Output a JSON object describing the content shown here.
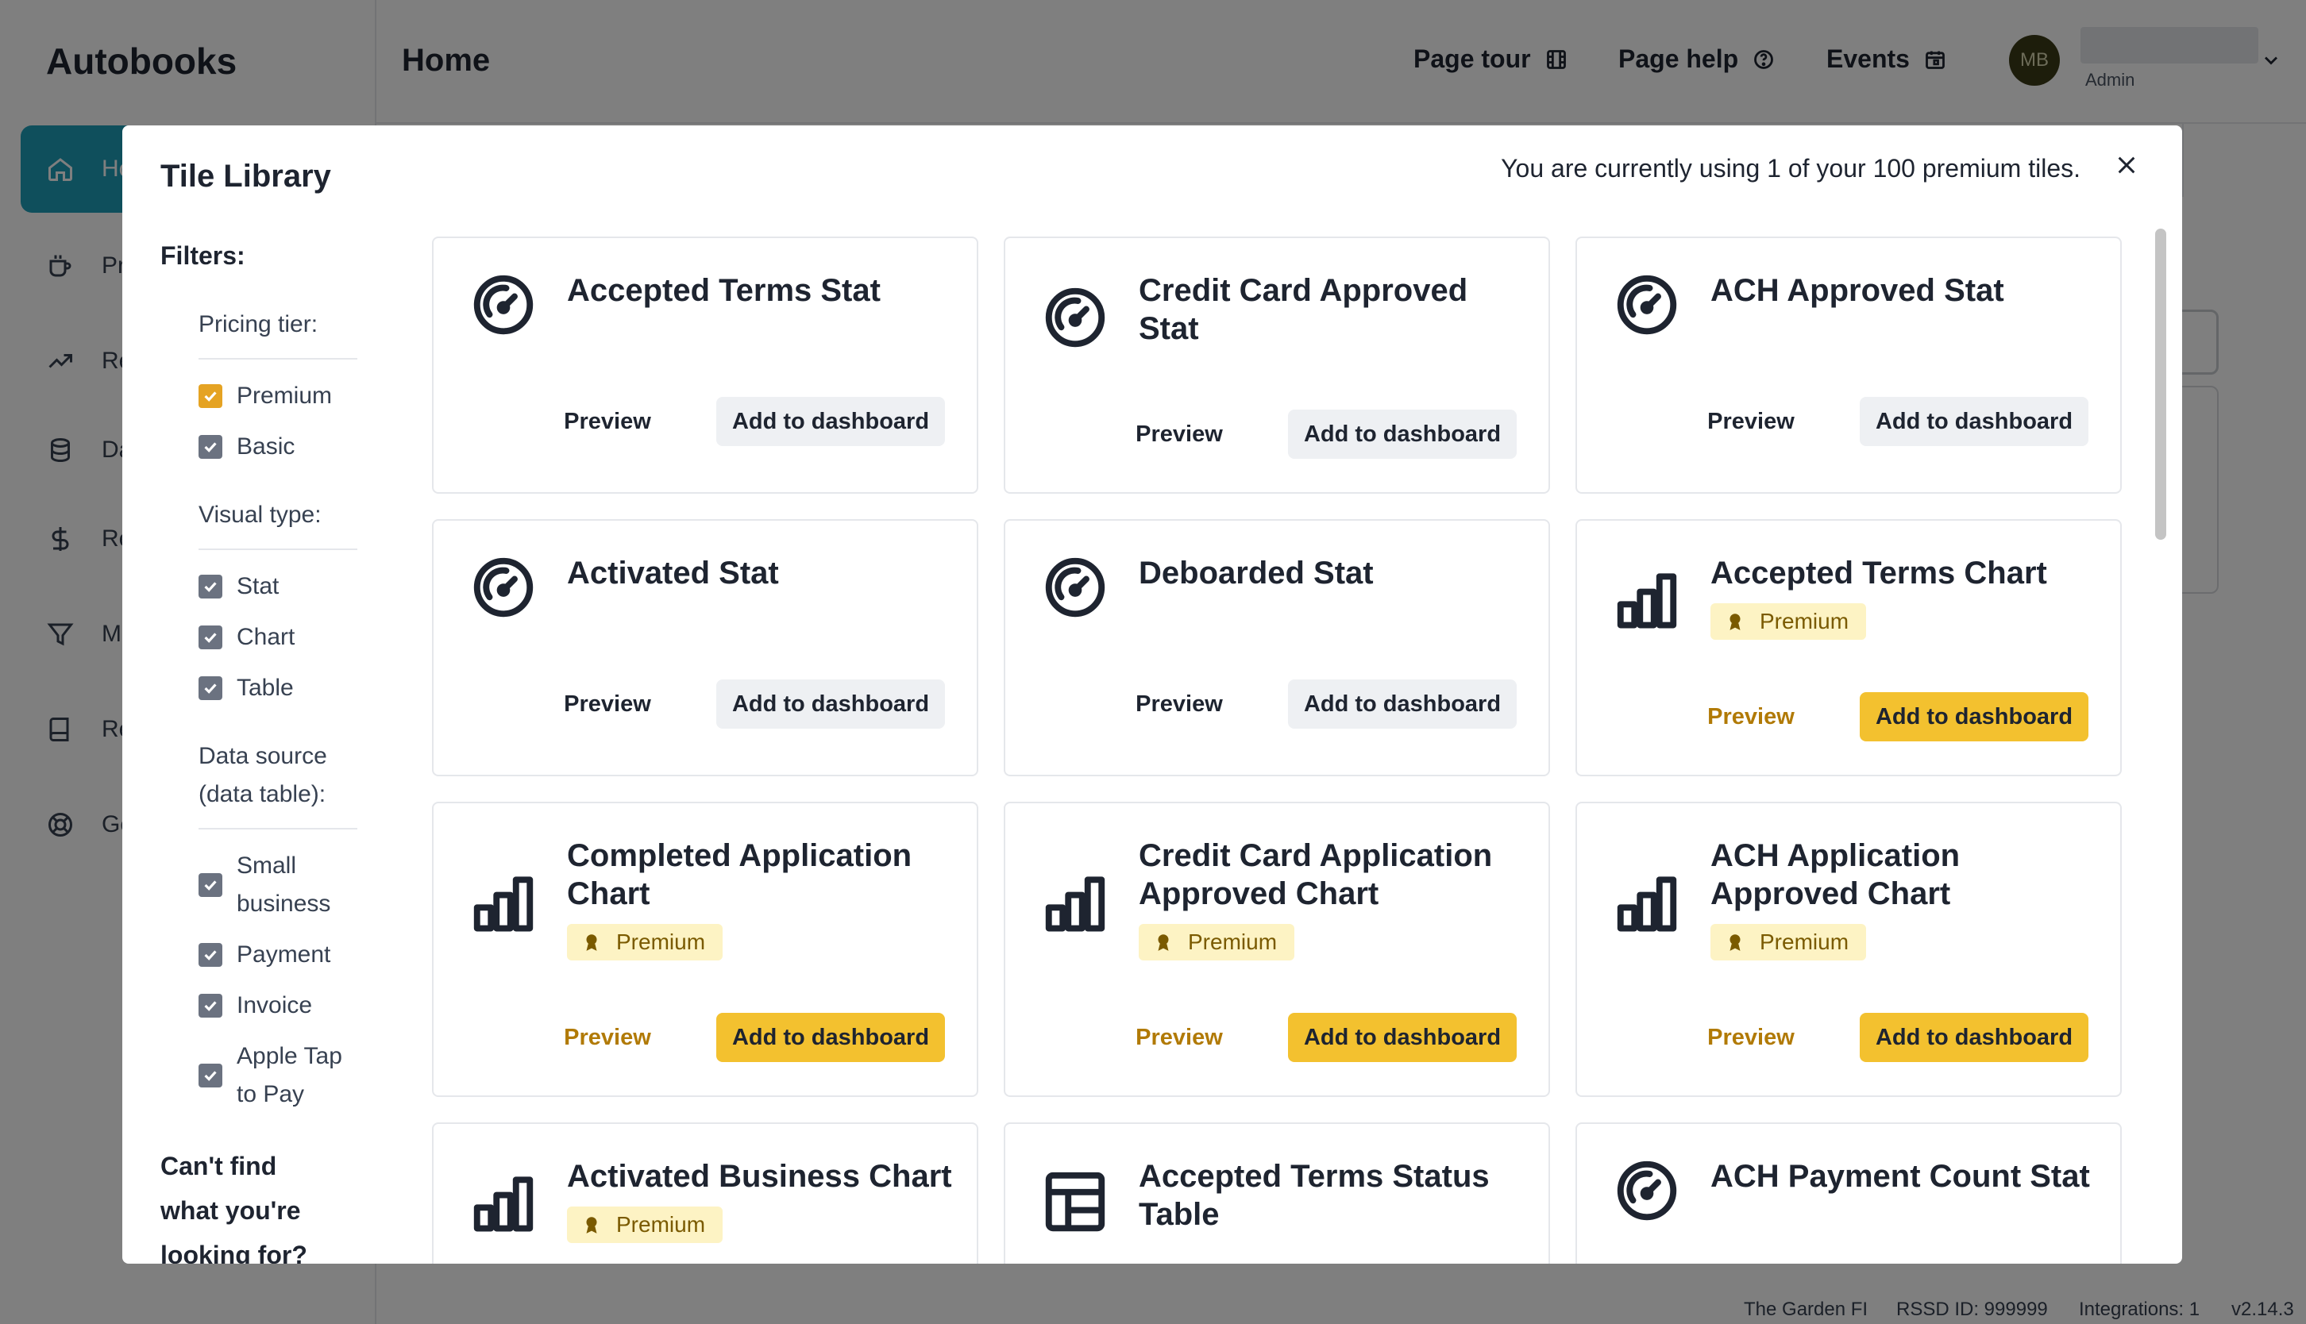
{
  "app": {
    "brand": "Autobooks",
    "page_title": "Home",
    "nav": [
      {
        "label": "Home",
        "icon": "home-icon",
        "active": true
      },
      {
        "label": "Products",
        "icon": "cup-icon"
      },
      {
        "label": "Reports",
        "icon": "trend-icon"
      },
      {
        "label": "Data",
        "icon": "database-icon"
      },
      {
        "label": "Revenue",
        "icon": "dollar-icon"
      },
      {
        "label": "Marketing",
        "icon": "filter-icon"
      },
      {
        "label": "Resources",
        "icon": "book-icon"
      },
      {
        "label": "Get help",
        "icon": "lifebuoy-icon"
      }
    ],
    "top_links": {
      "page_tour": "Page tour",
      "page_help": "Page help",
      "events": "Events"
    },
    "user": {
      "initials": "MB",
      "role": "Admin"
    },
    "footer": {
      "org": "The Garden FI",
      "rssd": "RSSD ID: 999999",
      "integrations": "Integrations: 1",
      "version": "v2.14.3"
    }
  },
  "modal": {
    "title": "Tile Library",
    "usage_text": "You are currently using 1 of your 100 premium tiles.",
    "filters": {
      "title": "Filters:",
      "groups": [
        {
          "title": "Pricing tier:",
          "options": [
            {
              "label": "Premium",
              "checked": true,
              "color": "#e5a323"
            },
            {
              "label": "Basic",
              "checked": true
            }
          ]
        },
        {
          "title": "Visual type:",
          "options": [
            {
              "label": "Stat",
              "checked": true
            },
            {
              "label": "Chart",
              "checked": true
            },
            {
              "label": "Table",
              "checked": true
            }
          ]
        },
        {
          "title": "Data source (data table):",
          "options": [
            {
              "label": "Small business",
              "checked": true
            },
            {
              "label": "Payment",
              "checked": true
            },
            {
              "label": "Invoice",
              "checked": true
            },
            {
              "label": "Apple Tap to Pay",
              "checked": true
            }
          ]
        }
      ],
      "cant_find": "Can't find what you're looking for?"
    },
    "preview_label": "Preview",
    "add_label": "Add to dashboard",
    "premium_label": "Premium",
    "tiles": [
      {
        "title": "Accepted Terms Stat",
        "icon": "gauge-icon",
        "premium": false
      },
      {
        "title": "Credit Card Approved Stat",
        "icon": "gauge-icon",
        "premium": false
      },
      {
        "title": "ACH Approved Stat",
        "icon": "gauge-icon",
        "premium": false
      },
      {
        "title": "Activated Stat",
        "icon": "gauge-icon",
        "premium": false
      },
      {
        "title": "Deboarded Stat",
        "icon": "gauge-icon",
        "premium": false
      },
      {
        "title": "Accepted Terms Chart",
        "icon": "bar-chart-icon",
        "premium": true
      },
      {
        "title": "Completed Application Chart",
        "icon": "bar-chart-icon",
        "premium": true
      },
      {
        "title": "Credit Card Application Approved Chart",
        "icon": "bar-chart-icon",
        "premium": true
      },
      {
        "title": "ACH Application Approved Chart",
        "icon": "bar-chart-icon",
        "premium": true
      },
      {
        "title": "Activated Business Chart",
        "icon": "bar-chart-icon",
        "premium": true
      },
      {
        "title": "Accepted Terms Status Table",
        "icon": "table-icon",
        "premium": false
      },
      {
        "title": "ACH Payment Count Stat",
        "icon": "gauge-icon",
        "premium": false
      }
    ],
    "colors": {
      "premium_button": "#f3c12f",
      "premium_badge": "#fdf3c4",
      "basic_button": "#eef0f3",
      "active_nav": "#1f9fb8"
    }
  }
}
